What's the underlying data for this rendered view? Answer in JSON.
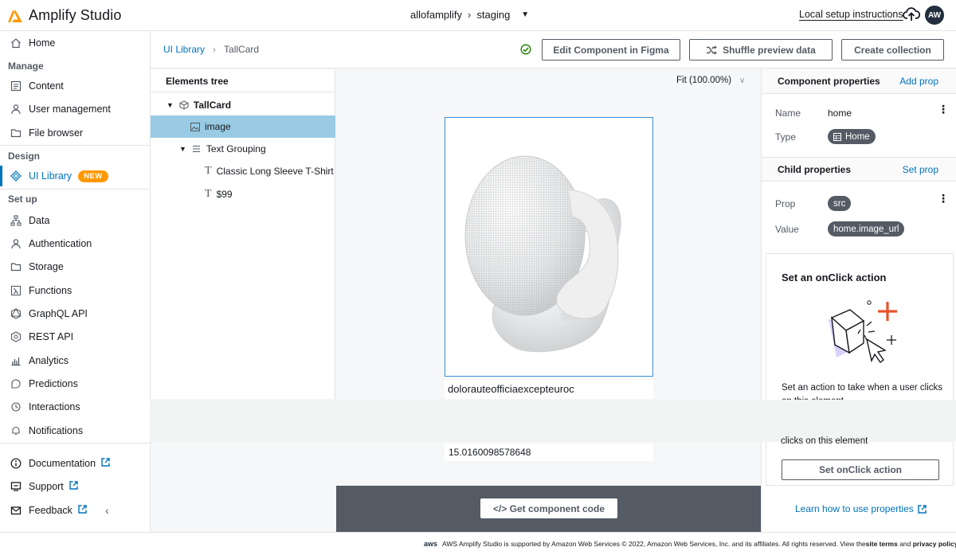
{
  "app": {
    "title": "Amplify Studio"
  },
  "header": {
    "app_name": "allofamplify",
    "env_name": "staging",
    "local_setup": "Local setup instructions",
    "avatar_initials": "AW"
  },
  "sidebar": {
    "home": "Home",
    "manage_section": "Manage",
    "content": "Content",
    "user_management": "User management",
    "file_browser": "File browser",
    "design_section": "Design",
    "ui_library": "UI Library",
    "new_badge": "NEW",
    "setup_section": "Set up",
    "data": "Data",
    "authentication": "Authentication",
    "storage": "Storage",
    "functions": "Functions",
    "graphql": "GraphQL API",
    "rest": "REST API",
    "analytics": "Analytics",
    "predictions": "Predictions",
    "interactions": "Interactions",
    "notifications": "Notifications",
    "documentation": "Documentation",
    "support": "Support",
    "feedback": "Feedback"
  },
  "breadcrumb": {
    "root": "UI Library",
    "current": "TallCard"
  },
  "toolbar": {
    "edit_figma": "Edit Component in Figma",
    "shuffle": "Shuffle preview data",
    "create_collection": "Create collection"
  },
  "tree": {
    "title": "Elements tree",
    "root": "TallCard",
    "image": "image",
    "text_grouping": "Text Grouping",
    "title_text": "Classic Long Sleeve T-Shirt",
    "price_text": "$99"
  },
  "preview": {
    "fit": "Fit (100.00%)",
    "card_title": "dolorauteofficiaexcepteuroc",
    "card_price": "15.0160098578648",
    "get_code": "</> Get component code"
  },
  "component_props": {
    "title": "Component properties",
    "add_prop": "Add prop",
    "name_label": "Name",
    "name_value": "home",
    "type_label": "Type",
    "type_value": "Home"
  },
  "child_props": {
    "title": "Child properties",
    "set_prop": "Set prop",
    "prop_label": "Prop",
    "prop_value": "src",
    "value_label": "Value",
    "value_value": "home.image_url"
  },
  "onclick": {
    "title": "Set an onClick action",
    "description": "Set an action to take when a user clicks on this element",
    "description_tail": "clicks on this element",
    "button": "Set onClick action"
  },
  "learn_link": "Learn how to use properties",
  "footer": {
    "logo": "aws",
    "text_prefix": "AWS Amplify Studio is supported by Amazon Web Services © 2022, Amazon Web Services, Inc. and its affiliates. All rights reserved. View the ",
    "terms": "site terms",
    "and": " and ",
    "privacy": "privacy policy",
    "end": " ."
  },
  "colors": {
    "accent": "#0073bb",
    "orange": "#ff9900",
    "selected_row": "#99cbe4",
    "dark": "#545b64"
  }
}
